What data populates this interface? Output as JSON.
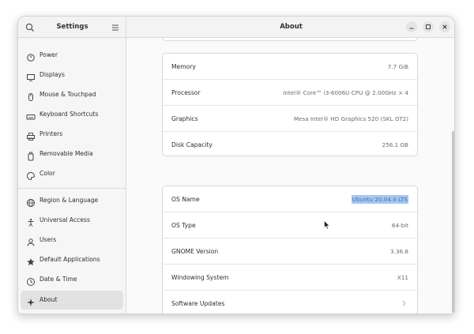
{
  "window": {
    "sidebar_title": "Settings",
    "page_title": "About"
  },
  "sidebar": {
    "items": [
      {
        "label": "Power",
        "icon": "power-icon"
      },
      {
        "label": "Displays",
        "icon": "display-icon"
      },
      {
        "label": "Mouse & Touchpad",
        "icon": "mouse-icon"
      },
      {
        "label": "Keyboard Shortcuts",
        "icon": "keyboard-icon"
      },
      {
        "label": "Printers",
        "icon": "printer-icon"
      },
      {
        "label": "Removable Media",
        "icon": "removable-media-icon"
      },
      {
        "label": "Color",
        "icon": "color-icon"
      },
      {
        "label": "Region & Language",
        "icon": "globe-icon"
      },
      {
        "label": "Universal Access",
        "icon": "accessibility-icon"
      },
      {
        "label": "Users",
        "icon": "users-icon"
      },
      {
        "label": "Default Applications",
        "icon": "star-icon"
      },
      {
        "label": "Date & Time",
        "icon": "clock-icon"
      },
      {
        "label": "About",
        "icon": "about-icon",
        "active": true
      }
    ]
  },
  "hardware": {
    "rows": [
      {
        "label": "Memory",
        "value": "7.7 GiB"
      },
      {
        "label": "Processor",
        "value": "Intel® Core™ i3-6006U CPU @ 2.00GHz × 4"
      },
      {
        "label": "Graphics",
        "value": "Mesa Intel® HD Graphics 520 (SKL GT2)"
      },
      {
        "label": "Disk Capacity",
        "value": "256.1 GB"
      }
    ]
  },
  "software": {
    "rows": [
      {
        "label": "OS Name",
        "value": "Ubuntu 20.04.4 LTS",
        "selected": true
      },
      {
        "label": "OS Type",
        "value": "64-bit"
      },
      {
        "label": "GNOME Version",
        "value": "3.36.8"
      },
      {
        "label": "Windowing System",
        "value": "X11"
      },
      {
        "label": "Software Updates",
        "value": "〉"
      }
    ]
  },
  "colors": {
    "selection": "#a7c7f2",
    "active_item": "#e2e2e2"
  }
}
